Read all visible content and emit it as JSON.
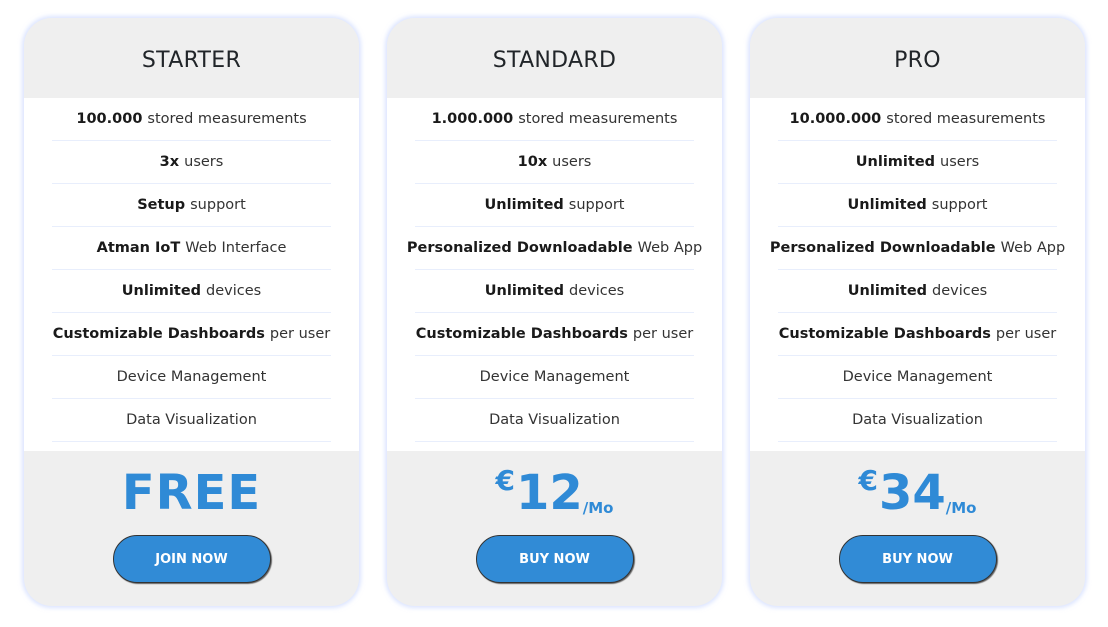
{
  "plans": [
    {
      "name": "STARTER",
      "features": [
        {
          "bold": "100.000",
          "text": "stored measurements"
        },
        {
          "bold": "3x",
          "text": "users"
        },
        {
          "bold": "Setup",
          "text": "support"
        },
        {
          "bold": "Atman IoT",
          "text": "Web Interface"
        },
        {
          "bold": "Unlimited",
          "text": "devices"
        },
        {
          "bold": "Customizable Dashboards",
          "text": "per user"
        },
        {
          "bold": "",
          "text": "Device Management"
        },
        {
          "bold": "",
          "text": "Data Visualization"
        }
      ],
      "price": {
        "free_label": "FREE",
        "currency": "",
        "amount": "",
        "period": ""
      },
      "cta_label": "JOIN NOW"
    },
    {
      "name": "STANDARD",
      "features": [
        {
          "bold": "1.000.000",
          "text": "stored measurements"
        },
        {
          "bold": "10x",
          "text": "users"
        },
        {
          "bold": "Unlimited",
          "text": "support"
        },
        {
          "bold": "Personalized Downloadable",
          "text": "Web App"
        },
        {
          "bold": "Unlimited",
          "text": "devices"
        },
        {
          "bold": "Customizable Dashboards",
          "text": "per user"
        },
        {
          "bold": "",
          "text": "Device Management"
        },
        {
          "bold": "",
          "text": "Data Visualization"
        }
      ],
      "price": {
        "free_label": "",
        "currency": "€",
        "amount": "12",
        "period": "/Mo"
      },
      "cta_label": "BUY NOW"
    },
    {
      "name": "PRO",
      "features": [
        {
          "bold": "10.000.000",
          "text": "stored measurements"
        },
        {
          "bold": "Unlimited",
          "text": "users"
        },
        {
          "bold": "Unlimited",
          "text": "support"
        },
        {
          "bold": "Personalized Downloadable",
          "text": "Web App"
        },
        {
          "bold": "Unlimited",
          "text": "devices"
        },
        {
          "bold": "Customizable Dashboards",
          "text": "per user"
        },
        {
          "bold": "",
          "text": "Device Management"
        },
        {
          "bold": "",
          "text": "Data Visualization"
        }
      ],
      "price": {
        "free_label": "",
        "currency": "€",
        "amount": "34",
        "period": "/Mo"
      },
      "cta_label": "BUY NOW"
    }
  ],
  "colors": {
    "accent": "#318bd6",
    "price_text": "#2f8ad6",
    "card_background": "#efefef",
    "feature_background": "#ffffff"
  }
}
